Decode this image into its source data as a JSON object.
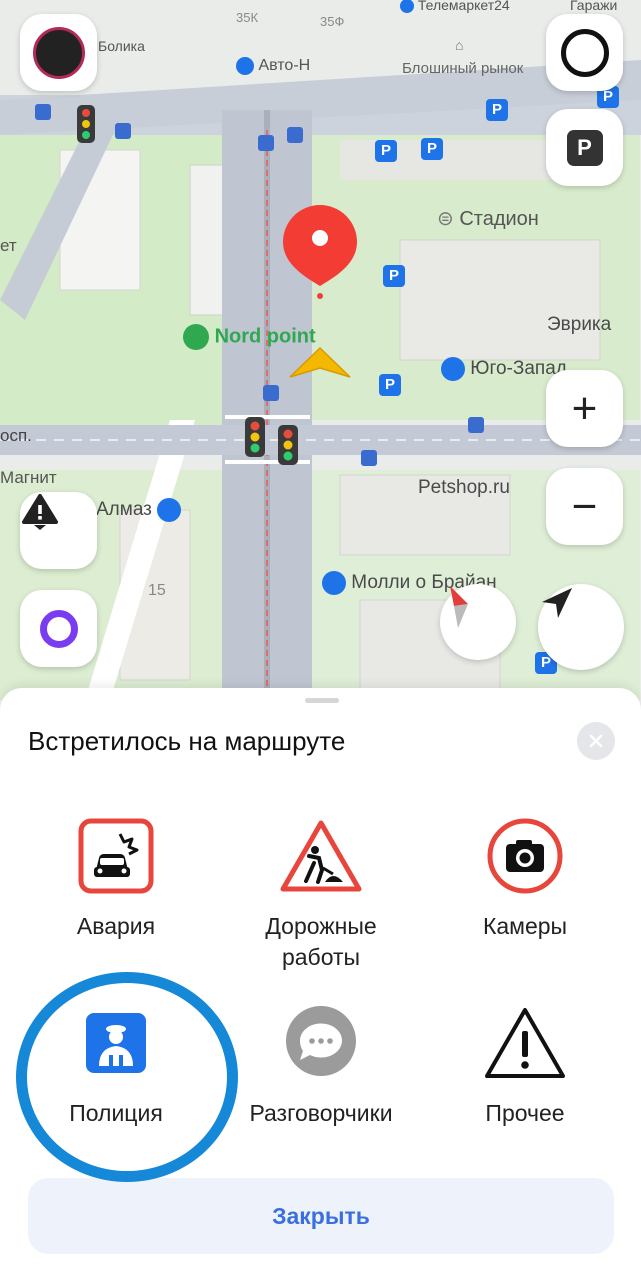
{
  "map": {
    "labels": {
      "telemarket": "Телемаркет24",
      "garage": "Гаражи",
      "bolika": "Болика",
      "auto": "Авто-Н",
      "flea": "Блошиный рынок",
      "b35k": "35К",
      "b35f": "35Ф",
      "stadium": "Стадион",
      "evrika": "Эврика",
      "nordpoint": "Nord point",
      "yugo": "Юго-Запад",
      "pr": "осп.",
      "et": "ет",
      "magnit": "Магнит",
      "almaz": "Алмаз",
      "petshop": "Petshop.ru",
      "molly": "Молли о Брайан",
      "n15": "15"
    },
    "parking_letter": "P",
    "controls": {
      "zoom_in": "+",
      "zoom_out": "−"
    },
    "colors": {
      "pin": "#f23c34",
      "green": "#2fa84f",
      "blue": "#1e73e8"
    }
  },
  "sheet": {
    "title": "Встретилось на маршруте",
    "items": [
      {
        "label": "Авария",
        "icon": "car-crash-icon"
      },
      {
        "label_line1": "Дорожные",
        "label_line2": "работы",
        "icon": "road-works-icon"
      },
      {
        "label": "Камеры",
        "icon": "camera-icon"
      },
      {
        "label": "Полиция",
        "icon": "police-icon"
      },
      {
        "label": "Разговорчики",
        "icon": "chat-icon"
      },
      {
        "label": "Прочее",
        "icon": "warning-icon"
      }
    ],
    "close_label": "Закрыть"
  }
}
